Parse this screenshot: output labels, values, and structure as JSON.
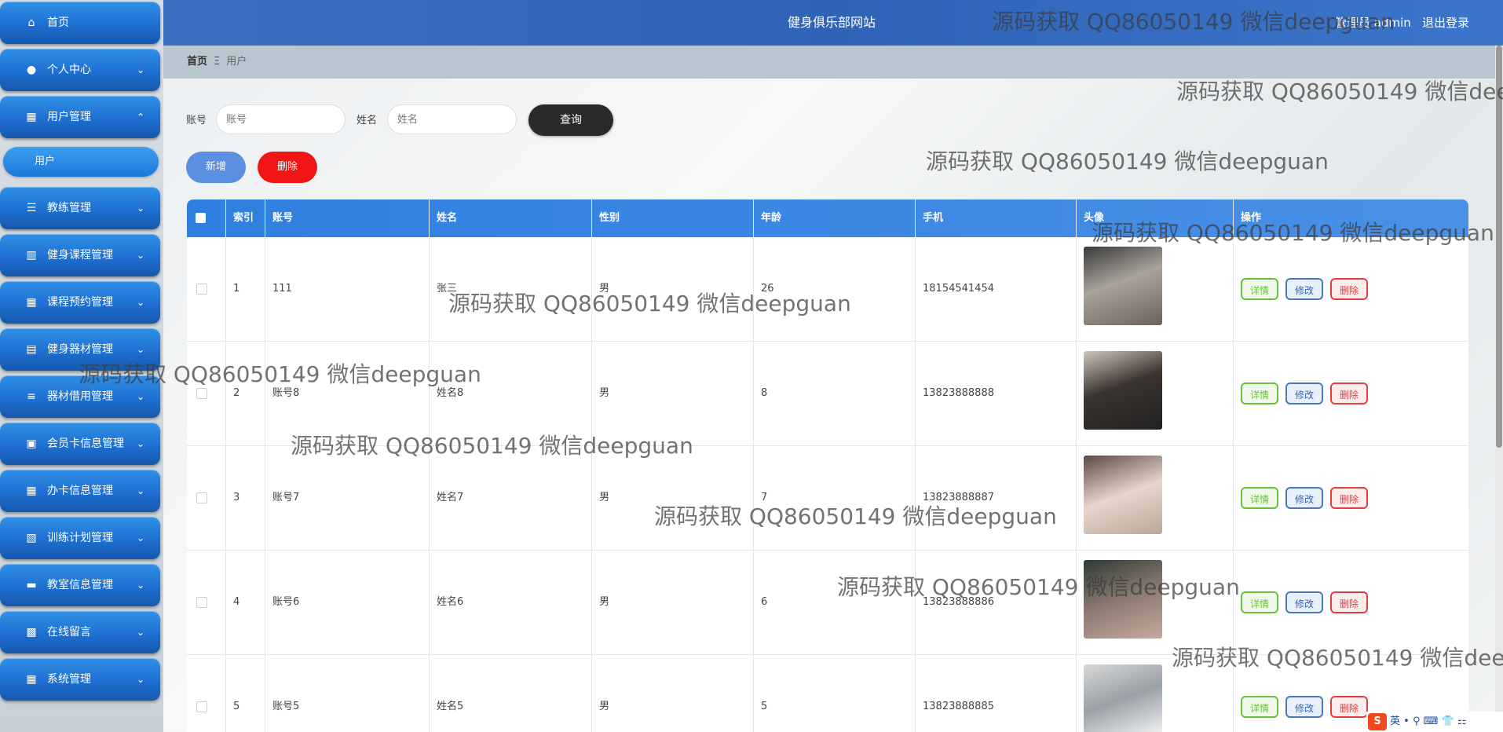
{
  "sidebar": {
    "items": [
      {
        "label": "首页",
        "icon": "home-icon",
        "glyph": "⌂",
        "chevron": ""
      },
      {
        "label": "个人中心",
        "icon": "user-icon",
        "glyph": "●",
        "chevron": "⌄"
      },
      {
        "label": "用户管理",
        "icon": "grid-icon",
        "glyph": "▦",
        "chevron": "⌃"
      },
      {
        "label": "教练管理",
        "icon": "sliders-icon",
        "glyph": "☰",
        "chevron": "⌄"
      },
      {
        "label": "健身课程管理",
        "icon": "book-icon",
        "glyph": "▥",
        "chevron": "⌄"
      },
      {
        "label": "课程预约管理",
        "icon": "grid-icon",
        "glyph": "▦",
        "chevron": "⌄"
      },
      {
        "label": "健身器材管理",
        "icon": "clipboard-icon",
        "glyph": "▤",
        "chevron": "⌄"
      },
      {
        "label": "器材借用管理",
        "icon": "list-icon",
        "glyph": "≡",
        "chevron": "⌄"
      },
      {
        "label": "会员卡信息管理",
        "icon": "check-icon",
        "glyph": "▣",
        "chevron": "⌄"
      },
      {
        "label": "办卡信息管理",
        "icon": "grid-icon",
        "glyph": "▦",
        "chevron": "⌄"
      },
      {
        "label": "训练计划管理",
        "icon": "clipboard-x-icon",
        "glyph": "▧",
        "chevron": "⌄"
      },
      {
        "label": "教室信息管理",
        "icon": "monitor-icon",
        "glyph": "▬",
        "chevron": "⌄"
      },
      {
        "label": "在线留言",
        "icon": "message-icon",
        "glyph": "▩",
        "chevron": "⌄"
      },
      {
        "label": "系统管理",
        "icon": "grid-icon",
        "glyph": "▦",
        "chevron": "⌄"
      }
    ],
    "sub_item": "用户"
  },
  "header": {
    "site_title": "健身俱乐部网站",
    "role": "管理员 admin",
    "logout": "退出登录"
  },
  "breadcrumb": {
    "home": "首页",
    "sep": "Ξ",
    "current": "用户"
  },
  "search": {
    "account_label": "账号",
    "account_placeholder": "账号",
    "name_label": "姓名",
    "name_placeholder": "姓名",
    "query_button": "查询"
  },
  "actions": {
    "add": "新增",
    "delete": "删除"
  },
  "table": {
    "headers": [
      "索引",
      "账号",
      "姓名",
      "性别",
      "年龄",
      "手机",
      "头像",
      "操作"
    ],
    "rows": [
      {
        "index": "1",
        "account": "111",
        "name": "张三",
        "gender": "男",
        "age": "26",
        "phone": "18154541454"
      },
      {
        "index": "2",
        "account": "账号8",
        "name": "姓名8",
        "gender": "男",
        "age": "8",
        "phone": "13823888888"
      },
      {
        "index": "3",
        "account": "账号7",
        "name": "姓名7",
        "gender": "男",
        "age": "7",
        "phone": "13823888887"
      },
      {
        "index": "4",
        "account": "账号6",
        "name": "姓名6",
        "gender": "男",
        "age": "6",
        "phone": "13823888886"
      },
      {
        "index": "5",
        "account": "账号5",
        "name": "姓名5",
        "gender": "男",
        "age": "5",
        "phone": "13823888885"
      }
    ],
    "ops": {
      "detail": "详情",
      "edit": "修改",
      "delete": "删除"
    }
  },
  "watermark": "源码获取 QQ86050149 微信deepguan",
  "ime": {
    "logo": "S",
    "lang": "英",
    "icons": "• ⚲ ⌨ 👕 ⚏"
  }
}
